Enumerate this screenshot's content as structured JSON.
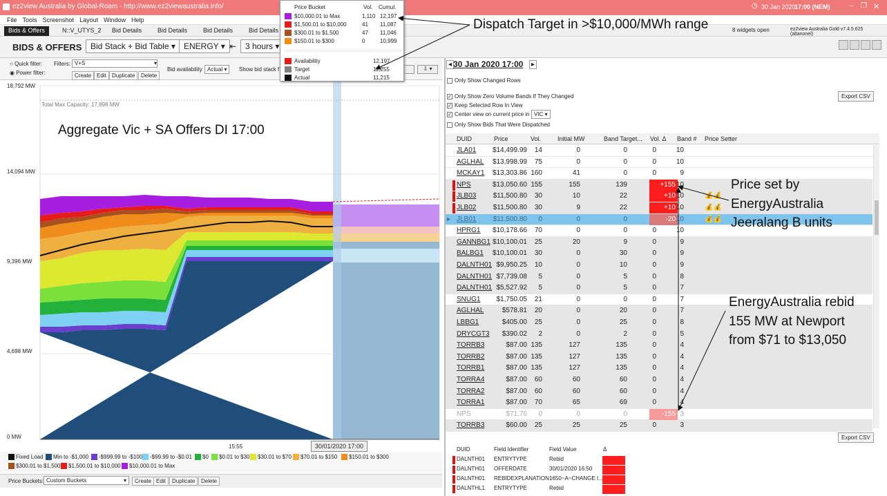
{
  "window": {
    "title": "ez2view Australia by Global-Roam - http://www.ez2viewaustralia.info/",
    "datetime": "30 Jan 2020",
    "time": "17:00 (NEM)",
    "widgets": "8 widgets open",
    "version": "ez2view Australia Gold v7.4.5.625 (altanonel)"
  },
  "menu": [
    "File",
    "Tools",
    "Screenshot",
    "Layout",
    "Window",
    "Help"
  ],
  "tabs": [
    "Bids & Offers",
    "N::V_UTYS_2",
    "Bid Details",
    "Bid Details",
    "Bid Details",
    "Bid Details"
  ],
  "toolbar": {
    "title": "BIDS & OFFERS",
    "view": "Bid Stack + Bid Table",
    "commodity": "ENERGY",
    "range": "3 hours"
  },
  "filters": {
    "quick": "Quick filter:",
    "power": "Power filter:",
    "filters_label": "Filters:",
    "filter_value": "V+S",
    "create": "Create",
    "edit": "Edit",
    "duplicate": "Duplicate",
    "delete": "Delete",
    "bid_availability": "Bid availability",
    "bid_avail_value": "Actual",
    "show_bid_stack": "Show bid stack f"
  },
  "chart": {
    "y_ticks": [
      "18,792 MW",
      "14,094 MW",
      "9,396 MW",
      "4,698 MW",
      "0 MW"
    ],
    "total_max": "Total Max Capacity: 17,898 MW",
    "x_tick": "15:55",
    "cursor_label": "30/01/2020 17:00"
  },
  "legend": [
    {
      "label": "Fixed Load",
      "color": "#111111"
    },
    {
      "label": "Min to -$1,000",
      "color": "#1f4e7a"
    },
    {
      "label": "-$999.99 to -$100",
      "color": "#6a3fd0"
    },
    {
      "label": "-$99.99 to -$0.01",
      "color": "#7fd0f5"
    },
    {
      "label": "$0",
      "color": "#22b23c"
    },
    {
      "label": "$0.01 to $30",
      "color": "#7be03a"
    },
    {
      "label": "$30.01 to $70",
      "color": "#dde830"
    },
    {
      "label": "$70.01 to $150",
      "color": "#f0b040"
    },
    {
      "label": "$150.01 to $300",
      "color": "#ef8c1a"
    },
    {
      "label": "$300.01 to $1,500",
      "color": "#a8501e"
    },
    {
      "label": "$1,500.01 to $10,000",
      "color": "#e51c1c"
    },
    {
      "label": "$10,000.01 to Max",
      "color": "#a81ee0"
    }
  ],
  "bottombar": {
    "label": "Price Buckets:",
    "value": "Custom Buckets",
    "create": "Create",
    "edit": "Edit",
    "duplicate": "Duplicate",
    "delete": "Delete"
  },
  "tooltip": {
    "header": [
      "Price Bucket",
      "Vol.",
      "Cumul."
    ],
    "rows": [
      {
        "label": "$10,000.01 to Max",
        "vol": "1,110",
        "cum": "12,197",
        "color": "#a81ee0"
      },
      {
        "label": "$1,500.01 to $10,000",
        "vol": "41",
        "cum": "11,087",
        "color": "#e51c1c"
      },
      {
        "label": "$300.01 to $1,500",
        "vol": "47",
        "cum": "11,046",
        "color": "#a8501e"
      },
      {
        "label": "$150.01 to $300",
        "vol": "0",
        "cum": "10,999",
        "color": "#ef8c1a"
      }
    ],
    "summary": [
      {
        "label": "Availability",
        "value": "12,197",
        "color": "#e51c1c"
      },
      {
        "label": "Target",
        "value": "11,255",
        "color": "#808080"
      },
      {
        "label": "Actual",
        "value": "11,215",
        "color": "#111111"
      }
    ]
  },
  "right": {
    "date": "30 Jan 2020 17:00",
    "only_changed": "Only Show Changed Rows",
    "zero_vol": "Only Show Zero Volume Bands If They Changed",
    "keep_selected": "Keep Selected Row In View",
    "center_view": "Center view on current price in",
    "region": "VIC",
    "only_dispatched": "Only Show Bids That Were Dispatched",
    "export": "Export CSV",
    "columns": [
      "DUID",
      "Price",
      "Vol.",
      "Initial MW",
      "Band Target...",
      "Vol. Δ",
      "Band #",
      "Price Setter"
    ],
    "rows": [
      [
        "JLA01",
        "$14,499.99",
        "14",
        "0",
        "0",
        "0",
        "10",
        "",
        "n"
      ],
      [
        "AGLHAL",
        "$13,998.99",
        "75",
        "0",
        "0",
        "0",
        "10",
        "",
        "n"
      ],
      [
        "MCKAY1",
        "$13,303.86",
        "160",
        "41",
        "0",
        "0",
        "9",
        "",
        "n"
      ],
      [
        "NPS",
        "$13,050.60",
        "155",
        "155",
        "139",
        "+155",
        "10",
        "",
        "red"
      ],
      [
        "JLB03",
        "$11,500.80",
        "30",
        "10",
        "22",
        "+10",
        "10",
        "💰💰",
        "red"
      ],
      [
        "JLB02",
        "$11,500.80",
        "30",
        "9",
        "22",
        "+10",
        "10",
        "💰💰",
        "red"
      ],
      [
        "JLB01",
        "$11,500.80",
        "0",
        "0",
        "0",
        "-20",
        "10",
        "💰💰",
        "sel"
      ],
      [
        "HPRG1",
        "$10,178.66",
        "70",
        "0",
        "0",
        "0",
        "10",
        "",
        "n"
      ],
      [
        "GANNBG1",
        "$10,100.01",
        "25",
        "20",
        "9",
        "0",
        "9",
        "",
        "g"
      ],
      [
        "BALBG1",
        "$10,100.01",
        "30",
        "0",
        "30",
        "0",
        "9",
        "",
        "g"
      ],
      [
        "DALNTH01",
        "$9,950.25",
        "10",
        "0",
        "10",
        "0",
        "9",
        "",
        "g"
      ],
      [
        "DALNTH01",
        "$7,739.08",
        "5",
        "0",
        "5",
        "0",
        "8",
        "",
        "g"
      ],
      [
        "DALNTH01",
        "$5,527.92",
        "5",
        "0",
        "5",
        "0",
        "7",
        "",
        "g"
      ],
      [
        "SNUG1",
        "$1,750.05",
        "21",
        "0",
        "0",
        "0",
        "7",
        "",
        "n"
      ],
      [
        "AGLHAL",
        "$578.81",
        "20",
        "0",
        "20",
        "0",
        "7",
        "",
        "g"
      ],
      [
        "LBBG1",
        "$405.00",
        "25",
        "0",
        "25",
        "0",
        "8",
        "",
        "g"
      ],
      [
        "DRYCGT3",
        "$390.02",
        "2",
        "0",
        "2",
        "0",
        "5",
        "",
        "g"
      ],
      [
        "TORRB3",
        "$87.00",
        "135",
        "127",
        "135",
        "0",
        "4",
        "",
        "g"
      ],
      [
        "TORRB2",
        "$87.00",
        "135",
        "127",
        "135",
        "0",
        "4",
        "",
        "g"
      ],
      [
        "TORRB1",
        "$87.00",
        "135",
        "127",
        "135",
        "0",
        "4",
        "",
        "g"
      ],
      [
        "TORRA4",
        "$87.00",
        "60",
        "60",
        "60",
        "0",
        "4",
        "",
        "g"
      ],
      [
        "TORRA2",
        "$87.00",
        "60",
        "60",
        "60",
        "0",
        "4",
        "",
        "g"
      ],
      [
        "TORRA1",
        "$87.00",
        "70",
        "65",
        "69",
        "0",
        "4",
        "",
        "g"
      ],
      [
        "NPS",
        "$71.76",
        "0",
        "0",
        "0",
        "-155",
        "3",
        "",
        "pink"
      ],
      [
        "TORRB3",
        "$60.00",
        "25",
        "25",
        "25",
        "0",
        "3",
        "",
        "g"
      ]
    ],
    "detail_columns": [
      "DUID",
      "Field Identifier",
      "Field Value",
      "Δ"
    ],
    "detail_rows": [
      [
        "DALNTH01",
        "ENTRYTYPE",
        "Rebid"
      ],
      [
        "DALNTH01",
        "OFFERDATE",
        "30/01/2020 16:50"
      ],
      [
        "DALNTH01",
        "REBIDEXPLANATION",
        "1650~A~CHANGE I..."
      ],
      [
        "DALNTHL1",
        "ENTRYTYPE",
        "Rebid"
      ]
    ]
  },
  "annotations": {
    "dispatch": "Dispatch Target in >$10,000/MWh range",
    "aggregate": "Aggregate Vic + SA Offers DI 17:00",
    "price_set": [
      "Price set by",
      "EnergyAustralia",
      "Jeeralang B units"
    ],
    "rebid": [
      "EnergyAustralia rebid",
      "155 MW at Newport",
      "from $71 to $13,050"
    ]
  }
}
